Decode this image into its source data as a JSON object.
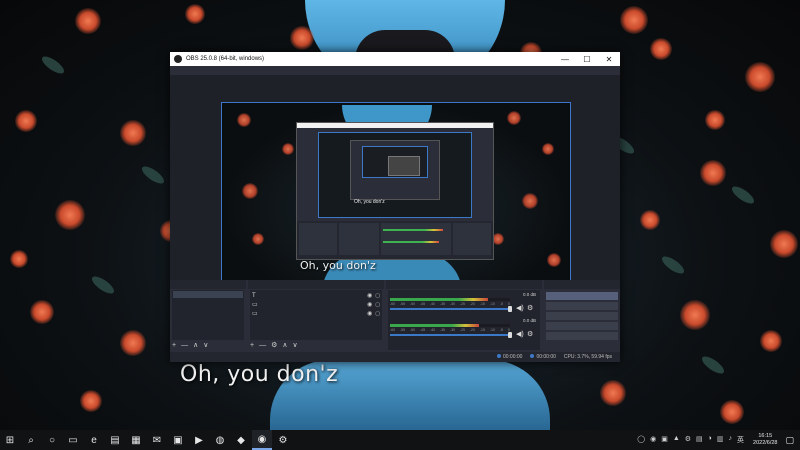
{
  "window": {
    "title": "OBS 25.0.8 (64-bit, windows)",
    "controls": {
      "minimize": "—",
      "maximize": "☐",
      "close": "✕"
    }
  },
  "menu": [
    {
      "label": ""
    },
    {
      "label": ""
    },
    {
      "label": ""
    },
    {
      "label": ""
    },
    {
      "label": ""
    },
    {
      "label": ""
    },
    {
      "label": ""
    },
    {
      "label": ""
    }
  ],
  "preview": {
    "caption": "Oh, you don'z",
    "nested_caption": "Oh, you don'z"
  },
  "docks": {
    "scenes": {
      "header": "",
      "items": [
        {
          "label": ""
        }
      ]
    },
    "sources": {
      "header": "",
      "items": [
        {
          "icon": "T",
          "label": ""
        },
        {
          "icon": "▭",
          "label": ""
        },
        {
          "icon": "▭",
          "label": ""
        }
      ]
    },
    "mixer": {
      "header": "",
      "channels": [
        {
          "label": "",
          "db": "0.0 dB",
          "level": 0.82
        },
        {
          "label": "",
          "db": "0.0 dB",
          "level": 0.74
        }
      ],
      "scale": [
        "-60",
        "-55",
        "-50",
        "-45",
        "-40",
        "-35",
        "-30",
        "-25",
        "-20",
        "-15",
        "-10",
        "-5",
        "0"
      ]
    },
    "controls": {
      "header": "",
      "buttons": [
        {
          "label": ""
        },
        {
          "label": ""
        },
        {
          "label": ""
        },
        {
          "label": ""
        },
        {
          "label": ""
        }
      ]
    },
    "toolbar": {
      "add": "+",
      "remove": "—",
      "settings": "⚙",
      "up": "∧",
      "down": "∨"
    }
  },
  "status": {
    "live_time": "00:00:00",
    "rec_time": "00:00:00",
    "cpu": "CPU: 3.7%, 59.94 fps"
  },
  "taskbar": {
    "start": "⊞",
    "search": "⌕",
    "task_view": "○",
    "apps": [
      {
        "name": "task-view-icon",
        "glyph": "▭"
      },
      {
        "name": "edge-icon",
        "glyph": "e"
      },
      {
        "name": "file-explorer-icon",
        "glyph": "▤"
      },
      {
        "name": "store-icon",
        "glyph": "▦"
      },
      {
        "name": "mail-icon",
        "glyph": "✉"
      },
      {
        "name": "photos-icon",
        "glyph": "▣"
      },
      {
        "name": "media-icon",
        "glyph": "▶"
      },
      {
        "name": "browser-icon",
        "glyph": "◍"
      },
      {
        "name": "app-orange-icon",
        "glyph": "◆"
      },
      {
        "name": "obs-icon",
        "glyph": "◉"
      },
      {
        "name": "steam-icon",
        "glyph": "⚙"
      }
    ],
    "tray": [
      "◯",
      "◉",
      "▣",
      "▲",
      "⚙",
      "▤",
      "◑",
      "▥",
      "♪",
      "英"
    ],
    "time": "16:15",
    "date": "2022/6/28",
    "notification": "▢"
  },
  "colors": {
    "obs_bg": "#2b2e38",
    "accent": "#3c78c8",
    "taskbar": "#101214"
  }
}
